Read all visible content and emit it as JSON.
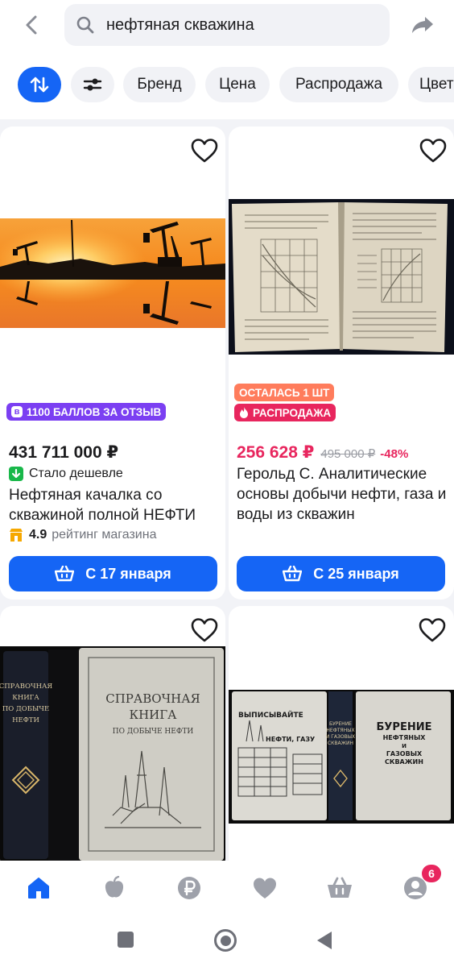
{
  "header": {
    "back_icon": "chevron-left-icon",
    "search_query": "нефтяная скважина",
    "search_icon": "search-icon",
    "share_icon": "share-arrow-icon"
  },
  "filters": {
    "sort_icon": "sort-icon",
    "params_icon": "filter-sliders-icon",
    "chips": [
      "Бренд",
      "Цена",
      "Распродажа",
      "Цвет"
    ]
  },
  "products": [
    {
      "image_alt": "oil pump jacks at sunset",
      "badge": "1100 БАЛЛОВ ЗА ОТЗЫВ",
      "price": "431 711 000 ₽",
      "price_tag": "Стало дешевле",
      "title": "Нефтяная качалка со скважиной полной НЕФТИ",
      "rating": "4.9",
      "rating_label": "рейтинг магазина",
      "delivery": "С 17 января"
    },
    {
      "image_alt": "open technical book",
      "badge_stock": "ОСТАЛАСЬ 1 ШТ",
      "badge_sale": "РАСПРОДАЖА",
      "price": "256 628 ₽",
      "old_price": "495 000 ₽",
      "discount": "-48%",
      "title": "Герольд С. Аналитические основы добычи нефти, газа и воды из скважин",
      "delivery": "С 25 января"
    },
    {
      "image_alt": "book Справочная книга по добыче нефти",
      "cover_spine": [
        "СПРАВОЧНАЯ",
        "КНИГА",
        "ПО ДОБЫЧЕ",
        "НЕФТИ"
      ],
      "cover_title": [
        "СПРАВОЧНАЯ",
        "КНИГА"
      ],
      "cover_subtitle": "ПО ДОБЫЧЕ НЕФТИ"
    },
    {
      "image_alt": "book Бурение нефтяных и газовых скважин",
      "left_cover": [
        "ВЫПИСЫВАЙТЕ",
        "НЕФТИ, ГАЗУ"
      ],
      "spine": [
        "БУРЕНИЕ",
        "НЕФТЯНЫХ",
        "И ГАЗОВЫХ",
        "СКВАЖИН"
      ],
      "right_cover": [
        "БУРЕНИЕ",
        "НЕФТЯНЫХ",
        "И",
        "ГАЗОВЫХ",
        "СКВАЖИН"
      ]
    }
  ],
  "tabbar": {
    "items": [
      "home-icon",
      "catalog-icon",
      "ruble-icon",
      "favorites-icon",
      "cart-icon",
      "profile-icon"
    ],
    "profile_badge": "6"
  },
  "colors": {
    "accent": "#1565f5",
    "sale": "#e8265e",
    "badge_points": "#7b3ff2",
    "badge_stock": "#ff7c5c",
    "price_down": "#19b84a",
    "rating_star": "#f6a800"
  }
}
